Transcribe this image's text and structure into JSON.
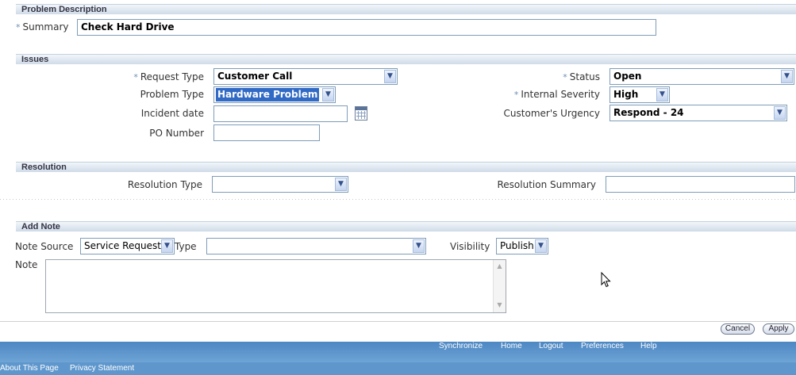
{
  "problem_description": {
    "section_title": "Problem Description",
    "summary_label": "Summary",
    "summary_value": "Check Hard Drive"
  },
  "issues": {
    "section_title": "Issues",
    "request_type_label": "Request Type",
    "request_type_value": "Customer Call",
    "problem_type_label": "Problem Type",
    "problem_type_value": "Hardware Problem",
    "incident_date_label": "Incident date",
    "incident_date_value": "",
    "po_number_label": "PO Number",
    "po_number_value": "",
    "status_label": "Status",
    "status_value": "Open",
    "internal_severity_label": "Internal Severity",
    "internal_severity_value": "High",
    "urgency_label": "Customer's Urgency",
    "urgency_value": "Respond - 24"
  },
  "resolution": {
    "section_title": "Resolution",
    "type_label": "Resolution Type",
    "type_value": "",
    "summary_label": "Resolution Summary",
    "summary_value": ""
  },
  "add_note": {
    "section_title": "Add Note",
    "note_source_label": "Note Source",
    "note_source_value": "Service Request",
    "type_label": "Type",
    "type_value": "",
    "visibility_label": "Visibility",
    "visibility_value": "Publish",
    "note_label": "Note",
    "note_value": ""
  },
  "actions": {
    "cancel": "Cancel",
    "apply": "Apply"
  },
  "footer": {
    "links": [
      "Synchronize",
      "Home",
      "Logout",
      "Preferences",
      "Help"
    ],
    "about": "About This Page",
    "privacy": "Privacy Statement"
  },
  "required_marker": "*",
  "icons": {
    "dropdown": "chevron-down-icon",
    "calendar": "calendar-icon",
    "cursor": "mouse-pointer-icon"
  },
  "colors": {
    "section_bar": "#cfdbe8",
    "footer": "#5f97cd",
    "selection": "#316ac5"
  }
}
